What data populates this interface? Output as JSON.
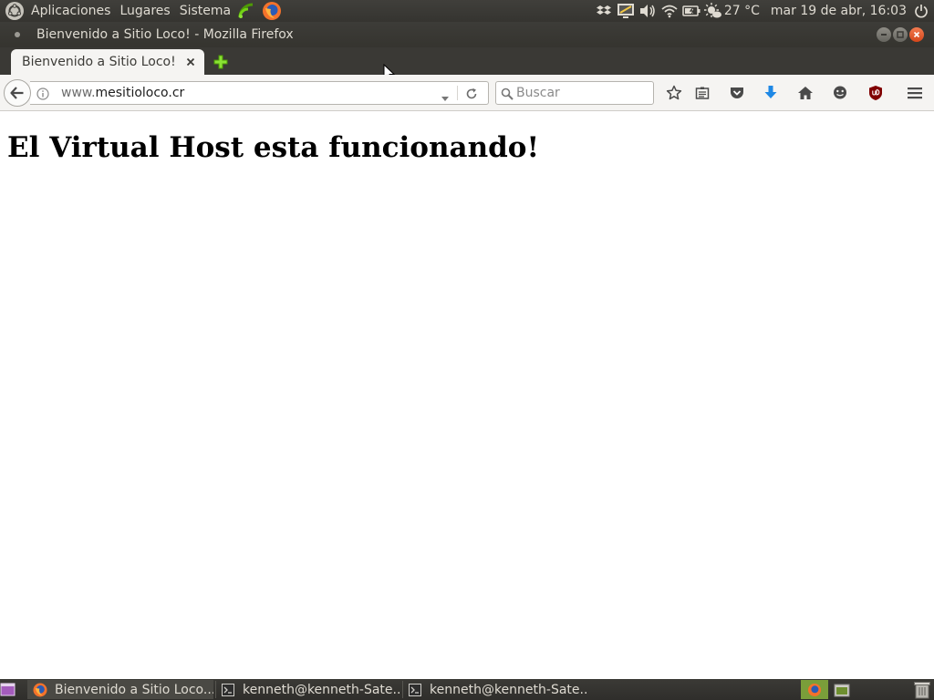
{
  "top_panel": {
    "menus": [
      "Aplicaciones",
      "Lugares",
      "Sistema"
    ],
    "temperature": "27 °C",
    "clock": "mar 19 de abr, 16:03"
  },
  "window": {
    "title": "Bienvenido a Sitio Loco! - Mozilla Firefox"
  },
  "tabs": [
    {
      "label": "Bienvenido a Sitio Loco!"
    }
  ],
  "navbar": {
    "url_prefix": "www.",
    "url_host": "mesitioloco.cr",
    "search_placeholder": "Buscar"
  },
  "page": {
    "heading": "El Virtual Host esta funcionando!"
  },
  "taskbar": {
    "tasks": [
      {
        "label": "Bienvenido a Sitio Loco..."
      },
      {
        "label": "kenneth@kenneth-Sate..."
      },
      {
        "label": "kenneth@kenneth-Sate..."
      }
    ]
  },
  "colors": {
    "panel": "#3c3b37",
    "toolbar": "#f5f4f2",
    "download_accent": "#1e88e5",
    "ublock": "#800000",
    "close_button": "#e2561e",
    "workspace_active": "#7a9e3a"
  },
  "icons": [
    "ubuntu-logo-icon",
    "signal-icon",
    "firefox-icon",
    "dropbox-icon",
    "display-icon",
    "volume-icon",
    "wifi-icon",
    "battery-icon",
    "weather-icon",
    "power-icon",
    "back-arrow-icon",
    "info-icon",
    "dropdown-icon",
    "reload-icon",
    "search-icon",
    "bookmark-star-icon",
    "reading-list-icon",
    "pocket-icon",
    "download-icon",
    "home-icon",
    "chat-icon",
    "ublock-icon",
    "hamburger-menu-icon",
    "terminal-icon",
    "trash-icon"
  ]
}
